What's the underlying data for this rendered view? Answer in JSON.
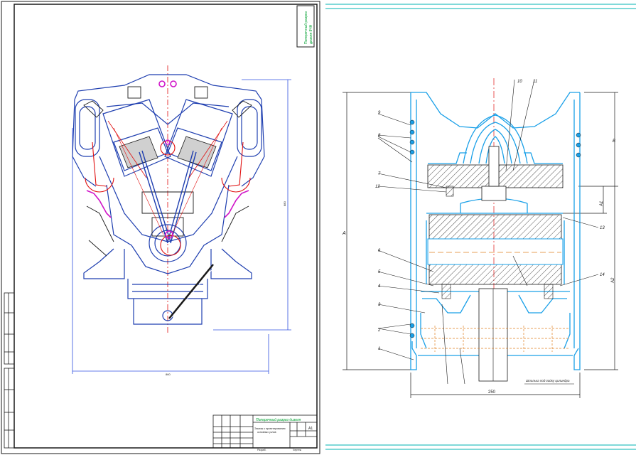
{
  "left_sheet": {
    "stamp_title": "Поперечный разрез дизеля",
    "stamp_subtitle_line1": "Эскизы к проектированию",
    "stamp_subtitle_line2": "основных узлов",
    "stamp_sheet": "А1",
    "stamp_bottom_left": "Разраб.",
    "stamp_bottom_right": "Чертеж",
    "side_note_line1": "Поперечный разрез",
    "side_note_line2": "дизеля 8ЧН",
    "dim_height": "880",
    "dim_width": "860"
  },
  "right_sheet": {
    "callouts": [
      "1",
      "2",
      "3",
      "4",
      "5",
      "6",
      "7",
      "8",
      "9",
      "10",
      "11",
      "12",
      "13",
      "14"
    ],
    "dimension_labels": [
      "A",
      "B",
      "A1",
      "A2",
      "250"
    ],
    "bottom_note": "Шпилька под гайку цилиндра"
  },
  "colors": {
    "outline": "#1a1a1a",
    "engine_blue": "#1f3fb0",
    "accent_red": "#e01010",
    "accent_magenta": "#d014c8",
    "liner_cyan": "#1aa0e8",
    "dim_line": "#3050e0",
    "hatch": "#222222",
    "teal_header": "#00b3b3",
    "label_green": "#00a030"
  }
}
